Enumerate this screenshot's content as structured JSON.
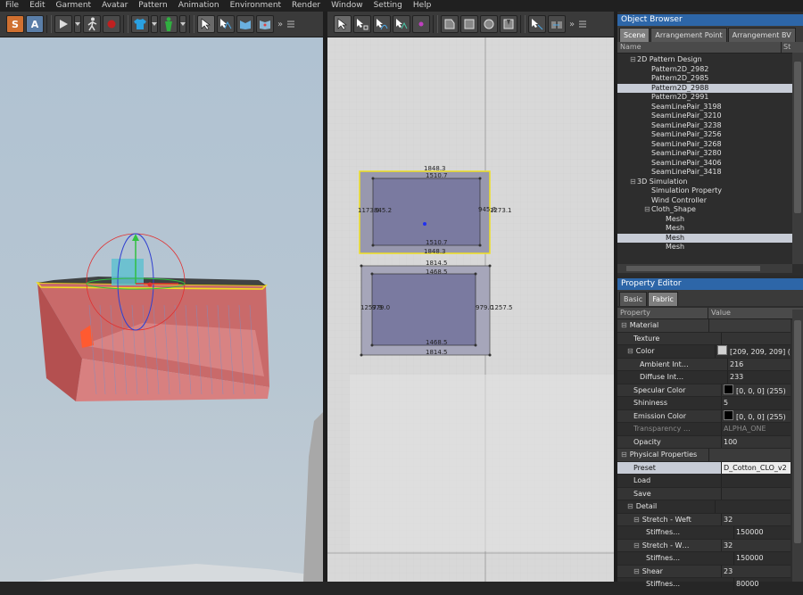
{
  "menu": [
    "File",
    "Edit",
    "Garment",
    "Avatar",
    "Pattern",
    "Animation",
    "Environment",
    "Render",
    "Window",
    "Setting",
    "Help"
  ],
  "colors": {
    "accent": "#2d66a8",
    "pattern_fill": "#8a8aa8",
    "selected_outline": "#f0e020",
    "cloth_red": "#c86060"
  },
  "toolbar_left": {
    "s_label": "S",
    "a_label": "A"
  },
  "pattern_top": {
    "top": "1848.3",
    "top_inner": "1510.7",
    "left": "1173.9",
    "left_inner": "845.2",
    "right_inner": "945.8",
    "right": "1273.1",
    "bottom_inner": "1510.7",
    "bottom": "1848.3"
  },
  "pattern_bottom": {
    "top": "1814.5",
    "top_inner": "1468.5",
    "left": "1257.9",
    "left_inner": "979.0",
    "right_inner": "979.0",
    "right": "1257.5",
    "bottom_inner": "1468.5",
    "bottom": "1814.5"
  },
  "object_browser": {
    "title": "Object Browser",
    "tabs": [
      "Scene",
      "Arrangement Point",
      "Arrangement BV"
    ],
    "col_name": "Name",
    "col_status": "St",
    "rows": [
      {
        "label": "2D Pattern Design",
        "indent": 1,
        "exp": "⊟",
        "sel": false,
        "dot": false
      },
      {
        "label": "Pattern2D_2982",
        "indent": 3,
        "exp": "",
        "sel": false,
        "dot": false
      },
      {
        "label": "Pattern2D_2985",
        "indent": 3,
        "exp": "",
        "sel": false,
        "dot": false
      },
      {
        "label": "Pattern2D_2988",
        "indent": 3,
        "exp": "",
        "sel": true,
        "dot": false
      },
      {
        "label": "Pattern2D_2991",
        "indent": 3,
        "exp": "",
        "sel": false,
        "dot": false
      },
      {
        "label": "SeamLinePair_3198",
        "indent": 3,
        "exp": "",
        "sel": false,
        "dot": true
      },
      {
        "label": "SeamLinePair_3210",
        "indent": 3,
        "exp": "",
        "sel": false,
        "dot": true
      },
      {
        "label": "SeamLinePair_3238",
        "indent": 3,
        "exp": "",
        "sel": false,
        "dot": true
      },
      {
        "label": "SeamLinePair_3256",
        "indent": 3,
        "exp": "",
        "sel": false,
        "dot": true
      },
      {
        "label": "SeamLinePair_3268",
        "indent": 3,
        "exp": "",
        "sel": false,
        "dot": true
      },
      {
        "label": "SeamLinePair_3280",
        "indent": 3,
        "exp": "",
        "sel": false,
        "dot": true
      },
      {
        "label": "SeamLinePair_3406",
        "indent": 3,
        "exp": "",
        "sel": false,
        "dot": true
      },
      {
        "label": "SeamLinePair_3418",
        "indent": 3,
        "exp": "",
        "sel": false,
        "dot": true
      },
      {
        "label": "3D Simulation",
        "indent": 1,
        "exp": "⊟",
        "sel": false,
        "dot": false
      },
      {
        "label": "Simulation Property",
        "indent": 3,
        "exp": "",
        "sel": false,
        "dot": false
      },
      {
        "label": "Wind Controller",
        "indent": 3,
        "exp": "",
        "sel": false,
        "dot": false
      },
      {
        "label": "Cloth_Shape",
        "indent": 3,
        "exp": "⊟",
        "sel": false,
        "dot": false
      },
      {
        "label": "Mesh",
        "indent": 5,
        "exp": "",
        "sel": false,
        "dot": false
      },
      {
        "label": "Mesh",
        "indent": 5,
        "exp": "",
        "sel": false,
        "dot": false
      },
      {
        "label": "Mesh",
        "indent": 5,
        "exp": "",
        "sel": true,
        "dot": false
      },
      {
        "label": "Mesh",
        "indent": 5,
        "exp": "",
        "sel": false,
        "dot": false
      }
    ]
  },
  "property_editor": {
    "title": "Property Editor",
    "tabs": [
      "Basic",
      "Fabric"
    ],
    "col_property": "Property",
    "col_value": "Value",
    "rows": [
      {
        "name": "Material",
        "value": "",
        "indent": 0,
        "exp": "⊟",
        "type": "group",
        "swatch": ""
      },
      {
        "name": "Texture",
        "value": "",
        "indent": 2,
        "exp": "",
        "type": "alt",
        "swatch": ""
      },
      {
        "name": "Color",
        "value": "[209, 209, 209] (…",
        "indent": 1,
        "exp": "⊟",
        "type": "",
        "swatch": "#d1d1d1"
      },
      {
        "name": "Ambient Int…",
        "value": "216",
        "indent": 3,
        "exp": "",
        "type": "alt",
        "swatch": ""
      },
      {
        "name": "Diffuse Int…",
        "value": "233",
        "indent": 3,
        "exp": "",
        "type": "",
        "swatch": ""
      },
      {
        "name": "Specular Color",
        "value": "[0, 0, 0] (255)",
        "indent": 2,
        "exp": "",
        "type": "alt",
        "swatch": "#000000"
      },
      {
        "name": "Shininess",
        "value": "5",
        "indent": 2,
        "exp": "",
        "type": "",
        "swatch": ""
      },
      {
        "name": "Emission Color",
        "value": "[0, 0, 0] (255)",
        "indent": 2,
        "exp": "",
        "type": "alt",
        "swatch": "#000000"
      },
      {
        "name": "Transparency …",
        "value": "ALPHA_ONE",
        "indent": 2,
        "exp": "",
        "type": "dim",
        "swatch": ""
      },
      {
        "name": "Opacity",
        "value": "100",
        "indent": 2,
        "exp": "",
        "type": "alt",
        "swatch": ""
      },
      {
        "name": "Physical Properties",
        "value": "",
        "indent": 0,
        "exp": "⊟",
        "type": "group",
        "swatch": ""
      },
      {
        "name": "Preset",
        "value": "D_Cotton_CLO_v2",
        "indent": 2,
        "exp": "",
        "type": "sel",
        "swatch": ""
      },
      {
        "name": "Load",
        "value": "",
        "indent": 2,
        "exp": "",
        "type": "",
        "swatch": ""
      },
      {
        "name": "Save",
        "value": "",
        "indent": 2,
        "exp": "",
        "type": "alt",
        "swatch": ""
      },
      {
        "name": "Detail",
        "value": "",
        "indent": 1,
        "exp": "⊟",
        "type": "",
        "swatch": ""
      },
      {
        "name": "Stretch - Weft",
        "value": "32",
        "indent": 2,
        "exp": "⊟",
        "type": "alt",
        "swatch": ""
      },
      {
        "name": "Stiffnes…",
        "value": "150000",
        "indent": 4,
        "exp": "",
        "type": "",
        "swatch": ""
      },
      {
        "name": "Stretch - W…",
        "value": "32",
        "indent": 2,
        "exp": "⊟",
        "type": "alt",
        "swatch": ""
      },
      {
        "name": "Stiffnes…",
        "value": "150000",
        "indent": 4,
        "exp": "",
        "type": "",
        "swatch": ""
      },
      {
        "name": "Shear",
        "value": "23",
        "indent": 2,
        "exp": "⊟",
        "type": "alt",
        "swatch": ""
      },
      {
        "name": "Stiffnes…",
        "value": "80000",
        "indent": 4,
        "exp": "",
        "type": "",
        "swatch": ""
      }
    ]
  }
}
